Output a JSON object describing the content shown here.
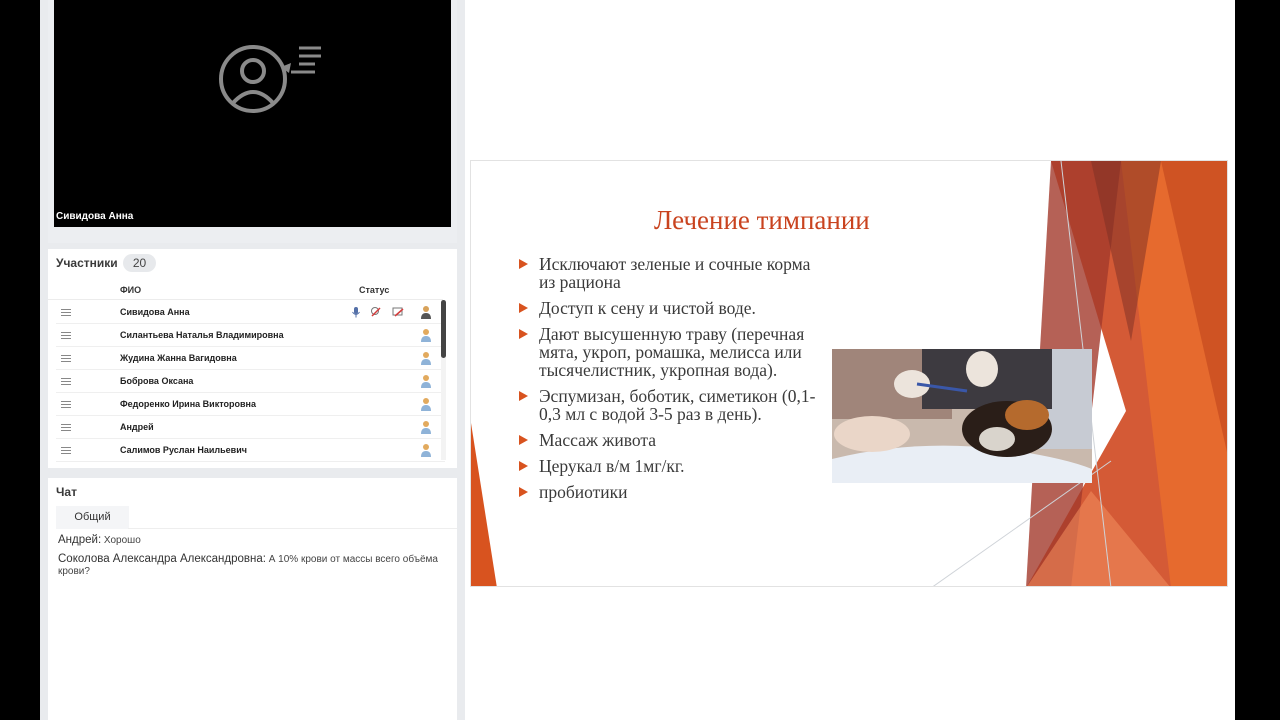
{
  "video": {
    "speaker_name": "Сивидова Анна",
    "icon": "person-speaking-icon"
  },
  "participants": {
    "title": "Участники",
    "count": "20",
    "col_name": "ФИО",
    "col_status": "Статус",
    "rows": [
      {
        "name": "Сивидова Анна"
      },
      {
        "name": "Силантьева Наталья Владимировна"
      },
      {
        "name": "Жудина Жанна  Вагидовна"
      },
      {
        "name": "Боброва Оксана"
      },
      {
        "name": "Федоренко Ирина  Викторовна"
      },
      {
        "name": "Андрей"
      },
      {
        "name": "Салимов Руслан Наильевич"
      }
    ]
  },
  "chat": {
    "title": "Чат",
    "tab": "Общий",
    "messages": [
      {
        "author": "Андрей:",
        "text": " Хорошо"
      },
      {
        "author": "Соколова Александра Александровна:",
        "text": " А 10% крови от массы всего объёма крови?"
      }
    ]
  },
  "slide": {
    "title": "Лечение тимпании",
    "bullets": [
      "Исключают зеленые и сочные корма из рациона",
      "Доступ к сену и чистой воде.",
      "Дают высушенную траву (перечная мята, укроп, ромашка, мелисса или тысячелистник, укропная вода).",
      "Эспумизан, боботик, симетикон (0,1-0,3 мл с водой 3-5 раз в день).",
      "Массаж живота",
      "Церукал в/м 1мг/кг.",
      "пробиотики"
    ],
    "accent_color": "#d8531f"
  }
}
